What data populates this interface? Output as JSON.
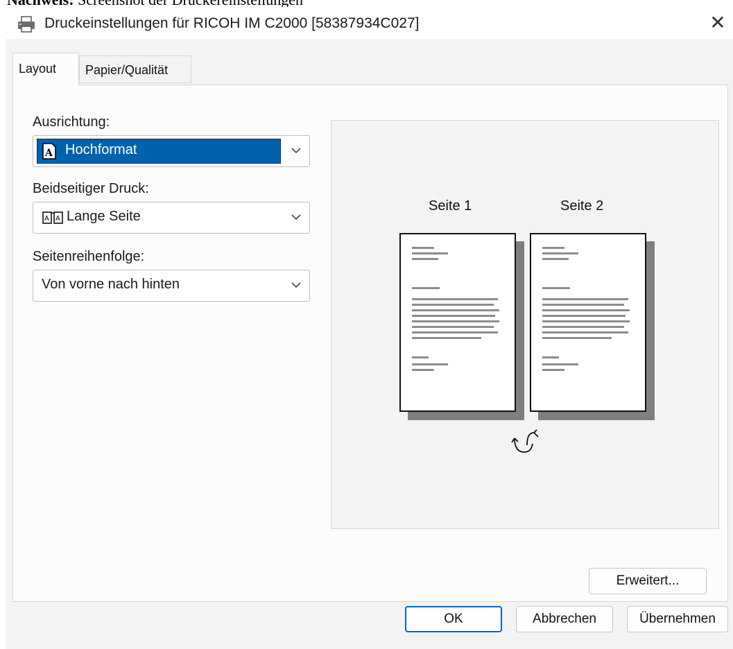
{
  "caption": {
    "bold": "Nachweis:",
    "text": " Screenshot der Druckereinstellungen"
  },
  "window": {
    "title": "Druckeinstellungen für RICOH IM C2000 [58387934C027]",
    "close_label": "✕",
    "app_icon": "printer-icon"
  },
  "tabs": [
    {
      "label": "Layout",
      "active": true
    },
    {
      "label": "Papier/Qualität",
      "active": false
    }
  ],
  "orientation": {
    "label": "Ausrichtung:",
    "value": "Hochformat",
    "icon": "portrait-page-icon"
  },
  "duplex": {
    "label": "Beidseitiger Druck:",
    "value": "Lange Seite",
    "icon": "long-edge-book-icon"
  },
  "page_order": {
    "label": "Seitenreihenfolge:",
    "value": "Von vorne nach hinten"
  },
  "preview": {
    "page1_label": "Seite 1",
    "page2_label": "Seite 2",
    "flip_icon": "flip-long-edge-icon"
  },
  "buttons": {
    "advanced": "Erweitert...",
    "ok": "OK",
    "cancel": "Abbrechen",
    "apply": "Übernehmen"
  },
  "colors": {
    "selection": "#0062ad",
    "primary_border": "#0067c0",
    "dialog_bg": "#f3f3f3"
  }
}
